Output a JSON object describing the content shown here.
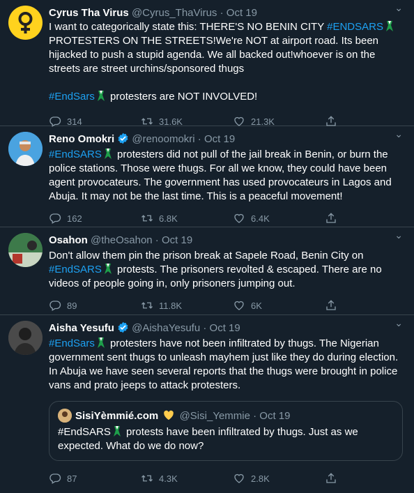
{
  "tweets": [
    {
      "name": "Cyrus Tha Virus",
      "handle": "@Cyrus_ThaVirus",
      "date": "Oct 19",
      "text_lines": [
        "I want to categorically state this: THERE'S NO BENIN CITY ",
        "#ENDSARS",
        " PROTESTERS ON THE STREETS!We're NOT at airport road. Its been hijacked to push a stupid agenda. We all backed out!whoever is on the streets are street urchins/sponsored thugs",
        "#EndSars",
        " protesters are NOT INVOLVED!"
      ],
      "replies": "314",
      "retweets": "31.6K",
      "likes": "21.3K"
    },
    {
      "name": "Reno Omokri",
      "handle": "@renoomokri",
      "date": "Oct 19",
      "tag": "#EndSARS",
      "text": " protesters did not pull of the jail break in Benin, or burn the police stations. Those were thugs. For all we know, they could have been agent provocateurs. The government has used provocateurs in Lagos and Abuja. It may not be the last time. This is a peaceful movement!",
      "replies": "162",
      "retweets": "6.8K",
      "likes": "6.4K"
    },
    {
      "name": "Osahon",
      "handle": "@theOsahon",
      "date": "Oct 19",
      "text_before": "Don't allow them pin the prison break at Sapele Road, Benin City on ",
      "tag": "#EndSARS",
      "text_after": " protests. The prisoners revolted & escaped. There are no videos of people going in, only prisoners jumping out.",
      "replies": "89",
      "retweets": "11.8K",
      "likes": "6K"
    },
    {
      "name": "Aisha Yesufu",
      "handle": "@AishaYesufu",
      "date": "Oct 19",
      "tag": "#EndSars",
      "text": " protesters have not been infiltrated by thugs. The Nigerian government sent thugs to unleash mayhem just like they do during election. In Abuja we have seen several reports that the thugs were brought in police vans and prato jeeps to attack protesters.",
      "quote": {
        "name": "SisiYèmmié.com",
        "handle": "@Sisi_Yemmie",
        "date": "Oct 19",
        "tag": "#EndSARS",
        "text": " protests have been infiltrated by thugs. Just as we expected. What do we do now?"
      },
      "replies": "87",
      "retweets": "4.3K",
      "likes": "2.8K"
    }
  ],
  "separator": " · ",
  "more_glyph": "⌄",
  "colors": {
    "background": "#15202b",
    "link": "#1da1f2",
    "muted": "#8899a6",
    "verified": "#1da1f2",
    "heart_emoji": "#ffcc4d"
  }
}
